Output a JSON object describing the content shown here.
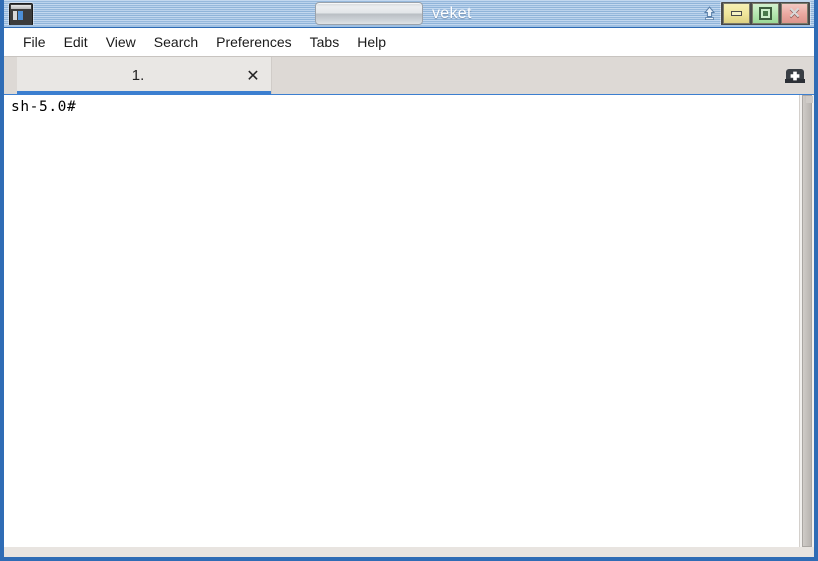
{
  "window": {
    "title": "veket",
    "app_icon": "terminal-book-icon",
    "shade_icon": "shade-up-arrow-icon",
    "controls": {
      "minimize_label": "–",
      "maximize_label": "□",
      "close_label": "✕"
    },
    "colors": {
      "border": "#2f6cb5",
      "titlebar_light": "#c3d8ef",
      "titlebar_dark": "#8fb4d9",
      "title_text": "#ffffff",
      "tabbar_bg": "#ddd9d5",
      "tab_active_bg": "#e9e7e4",
      "tab_underline": "#3c7fd0",
      "minimize_btn": "#efe59a",
      "maximize_btn": "#b3e6ae",
      "close_btn": "#eaa79f",
      "terminal_bg": "#ffffff",
      "terminal_fg": "#000000"
    }
  },
  "menubar": {
    "items": [
      {
        "label": "File"
      },
      {
        "label": "Edit"
      },
      {
        "label": "View"
      },
      {
        "label": "Search"
      },
      {
        "label": "Preferences"
      },
      {
        "label": "Tabs"
      },
      {
        "label": "Help"
      }
    ]
  },
  "tabbar": {
    "tabs": [
      {
        "label": "1.",
        "close_label": "✕",
        "active": true
      }
    ],
    "new_tab_icon": "plus-icon"
  },
  "terminal": {
    "lines": [
      "sh-5.0#"
    ]
  }
}
